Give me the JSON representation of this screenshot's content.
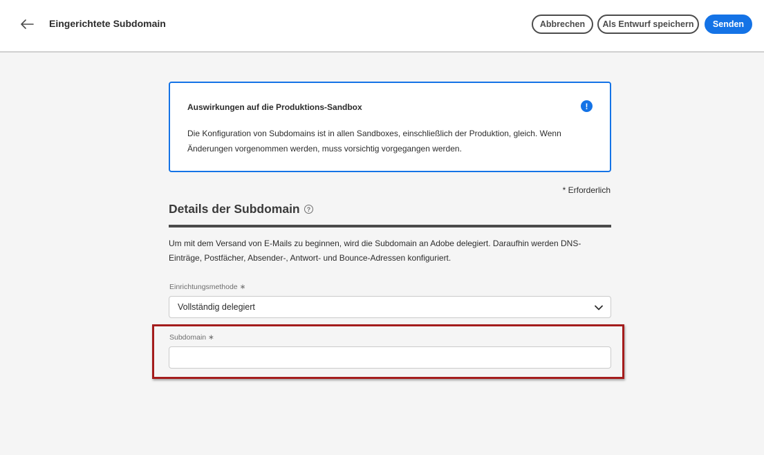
{
  "header": {
    "back_icon": "arrow-left-icon",
    "title": "Eingerichtete Subdomain",
    "cancel_label": "Abbrechen",
    "draft_label": "Als Entwurf speichern",
    "send_label": "Senden"
  },
  "alert": {
    "title": "Auswirkungen auf die Produktions-Sandbox",
    "icon": "exclamation-icon",
    "icon_glyph": "!",
    "body": "Die Konfiguration von Subdomains ist in allen Sandboxes, einschließlich der Produktion, gleich. Wenn  Änderungen vorgenommen werden, muss vorsichtig vorgegangen werden."
  },
  "form": {
    "required_note": "* Erforderlich",
    "section_title": "Details der Subdomain",
    "help_icon": "help-icon",
    "help_glyph": "?",
    "description": "Um mit dem Versand von E-Mails zu beginnen, wird die Subdomain an Adobe delegiert. Daraufhin werden DNS- Einträge, Postfächer, Absender-, Antwort- und Bounce-Adressen konfiguriert.",
    "method_label": "Einrichtungsmethode",
    "method_required_mark": "∗",
    "method_value": "Vollständig delegiert",
    "subdomain_label": "Subdomain",
    "subdomain_required_mark": "∗",
    "subdomain_value": "",
    "subdomain_placeholder": ""
  },
  "colors": {
    "accent": "#1473e6",
    "highlight_border": "#a41c1c"
  }
}
